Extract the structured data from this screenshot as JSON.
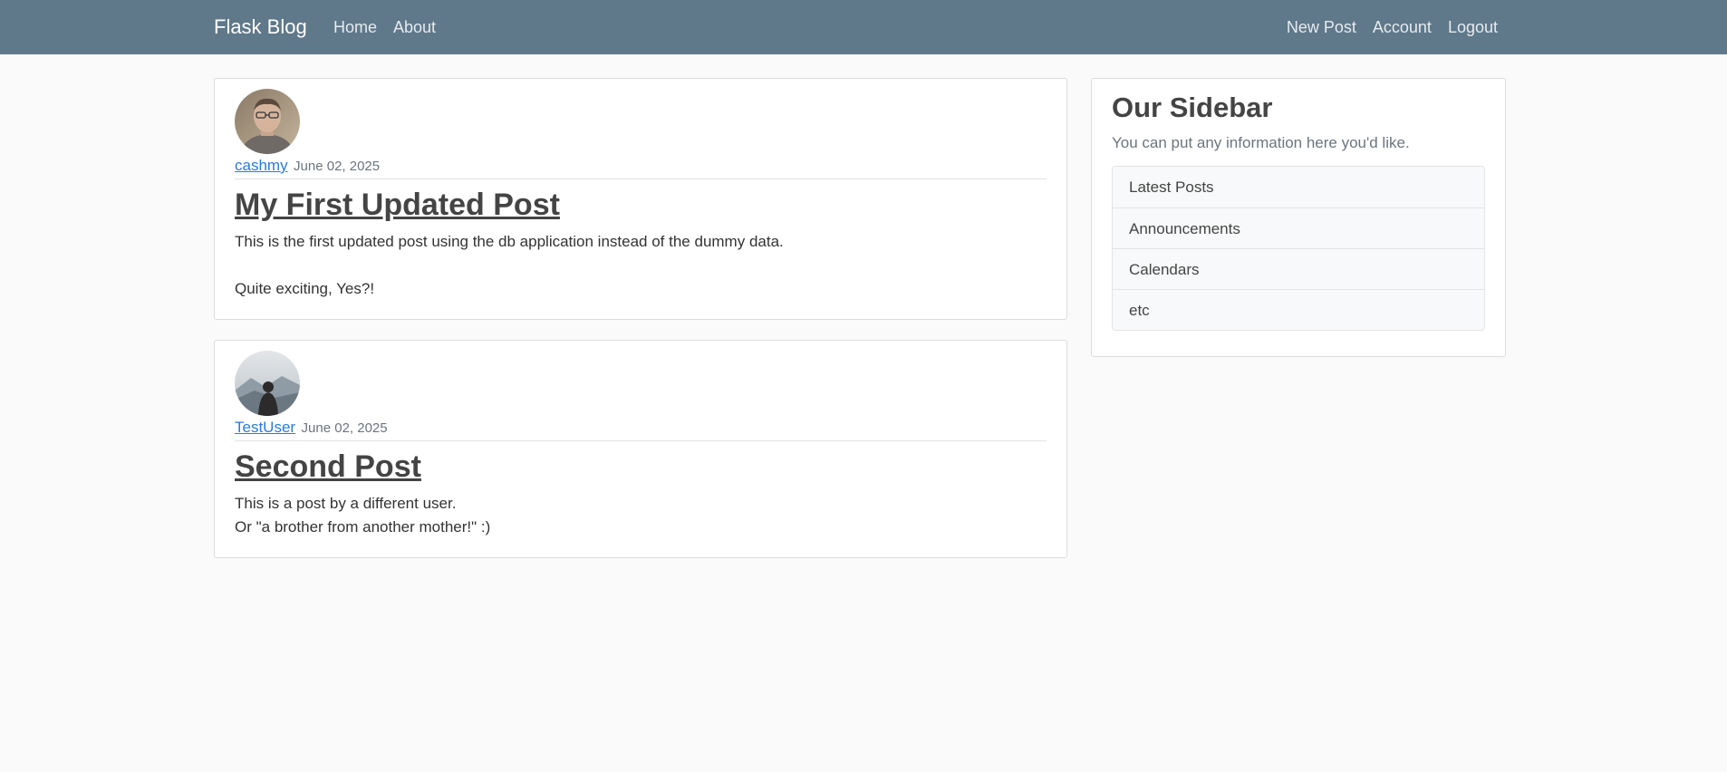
{
  "navbar": {
    "brand": "Flask Blog",
    "left_links": [
      "Home",
      "About"
    ],
    "right_links": [
      "New Post",
      "Account",
      "Logout"
    ]
  },
  "posts": [
    {
      "author": "cashmy",
      "date": "June 02, 2025",
      "title": "My First Updated Post",
      "content": "This is the first updated post using the db application instead of the dummy data.\n\nQuite exciting, Yes?!"
    },
    {
      "author": "TestUser",
      "date": "June 02, 2025",
      "title": "Second Post",
      "content": "This is a post by a different user.\nOr \"a brother from another mother!\" :)"
    }
  ],
  "sidebar": {
    "title": "Our Sidebar",
    "text": "You can put any information here you'd like.",
    "items": [
      "Latest Posts",
      "Announcements",
      "Calendars",
      "etc"
    ]
  },
  "colors": {
    "navbar": "#5f788a",
    "background": "#fafafa",
    "link": "#2b7ad9"
  }
}
